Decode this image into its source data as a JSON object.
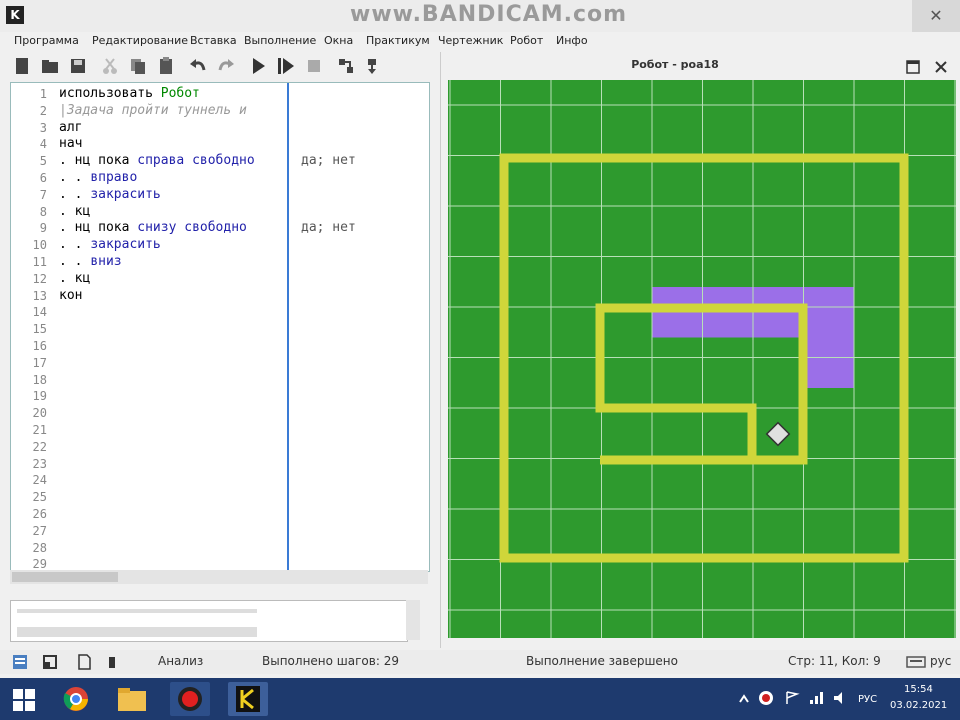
{
  "app": {
    "icon_letter": "K",
    "watermark": "www.BANDICAM.com",
    "close_symbol": "✕"
  },
  "menu": [
    "Программа",
    "Редактирование",
    "Вставка",
    "Выполнение",
    "Окна",
    "Практикум",
    "Чертежник",
    "Робот",
    "Инфо"
  ],
  "editor": {
    "line_numbers": [
      "1",
      "2",
      "3",
      "4",
      "5",
      "6",
      "7",
      "8",
      "9",
      "10",
      "11",
      "12",
      "13",
      "14",
      "15",
      "16",
      "17",
      "18",
      "19",
      "20",
      "21",
      "22",
      "23",
      "24",
      "25",
      "26",
      "27",
      "28",
      "29"
    ],
    "lines": [
      [
        {
          "t": "использовать ",
          "c": "kw"
        },
        {
          "t": "Робот",
          "c": "gr"
        }
      ],
      [
        {
          "t": "|Задача пройти туннель и",
          "c": "cm"
        }
      ],
      [
        {
          "t": "алг",
          "c": "kw"
        }
      ],
      [
        {
          "t": "нач",
          "c": "kw"
        }
      ],
      [
        {
          "t": ". нц пока ",
          "c": "kw"
        },
        {
          "t": "справа свободно",
          "c": "bl"
        }
      ],
      [
        {
          "t": ". . ",
          "c": "kw"
        },
        {
          "t": "вправо",
          "c": "bl"
        }
      ],
      [
        {
          "t": ". . ",
          "c": "kw"
        },
        {
          "t": "закрасить",
          "c": "bl"
        }
      ],
      [
        {
          "t": ". кц",
          "c": "kw"
        }
      ],
      [
        {
          "t": ". нц пока ",
          "c": "kw"
        },
        {
          "t": "снизу свободно",
          "c": "bl"
        }
      ],
      [
        {
          "t": ". . ",
          "c": "kw"
        },
        {
          "t": "закрасить",
          "c": "bl"
        }
      ],
      [
        {
          "t": ". . ",
          "c": "kw"
        },
        {
          "t": "вниз",
          "c": "bl"
        }
      ],
      [
        {
          "t": ". кц",
          "c": "kw"
        }
      ],
      [
        {
          "t": "кон",
          "c": "kw"
        }
      ]
    ],
    "margin_notes": [
      {
        "line": 5,
        "text": "да; нет"
      },
      {
        "line": 9,
        "text": "да; нет"
      }
    ]
  },
  "robot": {
    "panel_title": "Робот - poa18",
    "grid": {
      "cols": 10,
      "rows": 11
    },
    "painted_cells": [
      [
        3,
        4
      ],
      [
        4,
        4
      ],
      [
        5,
        4
      ],
      [
        6,
        4
      ],
      [
        6,
        5
      ]
    ],
    "robot_cell": [
      6,
      6
    ]
  },
  "status": {
    "mode": "Анализ",
    "steps": "Выполнено шагов: 29",
    "state": "Выполнение завершено",
    "position": "Стр: 11, Кол: 9",
    "lang": "рус"
  },
  "taskbar": {
    "tray_lang": "РУС",
    "clock_time": "15:54",
    "clock_date": "03.02.2021"
  },
  "colors": {
    "field_green": "#2e9a2e",
    "wall_yellow": "#cfd63a",
    "paint_purple": "#9b6fe8",
    "grid_line": "#b8e0b8",
    "robot_fill": "#e0e0e0"
  }
}
